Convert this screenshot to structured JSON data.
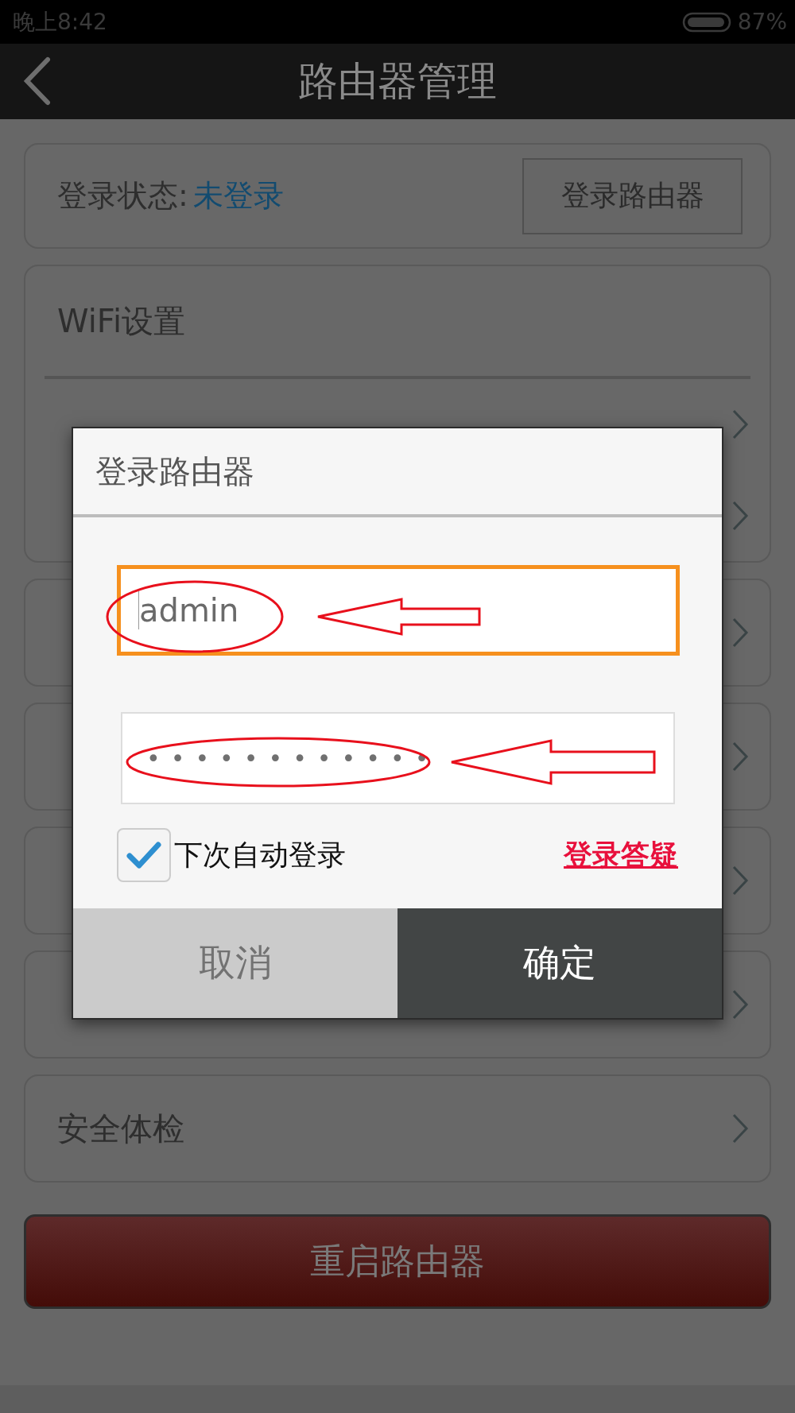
{
  "status_bar": {
    "time": "晚上8:42",
    "battery": "87%"
  },
  "header": {
    "title": "路由器管理"
  },
  "login_card": {
    "label": "登录状态:",
    "status": "未登录",
    "button": "登录路由器"
  },
  "wifi_card": {
    "title": "WiFi设置",
    "rows": [
      {
        "kind": "covered"
      },
      {
        "kind": "covered"
      }
    ]
  },
  "menu": [
    {
      "kind": "covered"
    },
    {
      "kind": "covered"
    },
    {
      "kind": "covered"
    },
    {
      "kind": "covered"
    },
    {
      "kind": "item",
      "label": "安全体检"
    }
  ],
  "reboot_button": "重启路由器",
  "dialog": {
    "title": "登录路由器",
    "username": {
      "value": "admin",
      "focused": true
    },
    "password": {
      "masked": "••••••••••••",
      "focused": false
    },
    "auto_login": {
      "label": "下次自动登录",
      "checked": true
    },
    "help_link": "登录答疑",
    "buttons": [
      {
        "kind": "cancel",
        "label": "取消"
      },
      {
        "kind": "confirm",
        "label": "确定"
      }
    ]
  }
}
